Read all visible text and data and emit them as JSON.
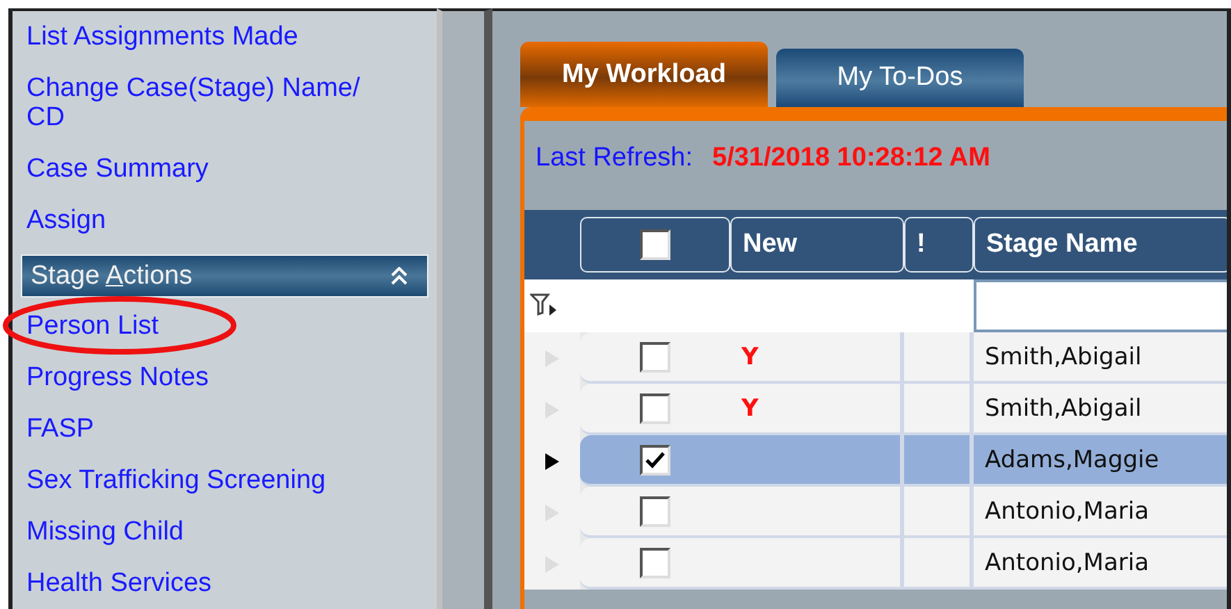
{
  "sidebar": {
    "top_items": [
      "List Assignments Made",
      "Change Case(Stage) Name/ CD",
      "Case Summary",
      "Assign"
    ],
    "section": {
      "title": "Stage **A**ctions",
      "expanded": true
    },
    "items": [
      {
        "label": "Person List",
        "circled": true
      },
      {
        "label": "Progress Notes",
        "circled": false
      },
      {
        "label": "FASP",
        "circled": false
      },
      {
        "label": "Sex Trafficking Screening",
        "circled": false
      },
      {
        "label": "Missing Child",
        "circled": false
      },
      {
        "label": "Health Services",
        "circled": false
      }
    ]
  },
  "tabs": [
    {
      "label": "My Workload",
      "selected": true
    },
    {
      "label": "My To-Dos",
      "selected": false
    }
  ],
  "refresh": {
    "label": "Last Refresh:",
    "value": "5/31/2018 10:28:12 AM"
  },
  "table": {
    "select_all": {
      "checked": false
    },
    "columns": [
      "New",
      "!",
      "Stage Name"
    ],
    "rows": [
      {
        "new": "Y",
        "stage_name": "Smith,Abigail",
        "checked": false,
        "selected": false
      },
      {
        "new": "Y",
        "stage_name": "Smith,Abigail",
        "checked": false,
        "selected": false
      },
      {
        "new": "",
        "stage_name": "Adams,Maggie",
        "checked": true,
        "selected": true
      },
      {
        "new": "",
        "stage_name": "Antonio,Maria",
        "checked": false,
        "selected": false
      },
      {
        "new": "",
        "stage_name": "Antonio,Maria",
        "checked": false,
        "selected": false
      }
    ]
  }
}
